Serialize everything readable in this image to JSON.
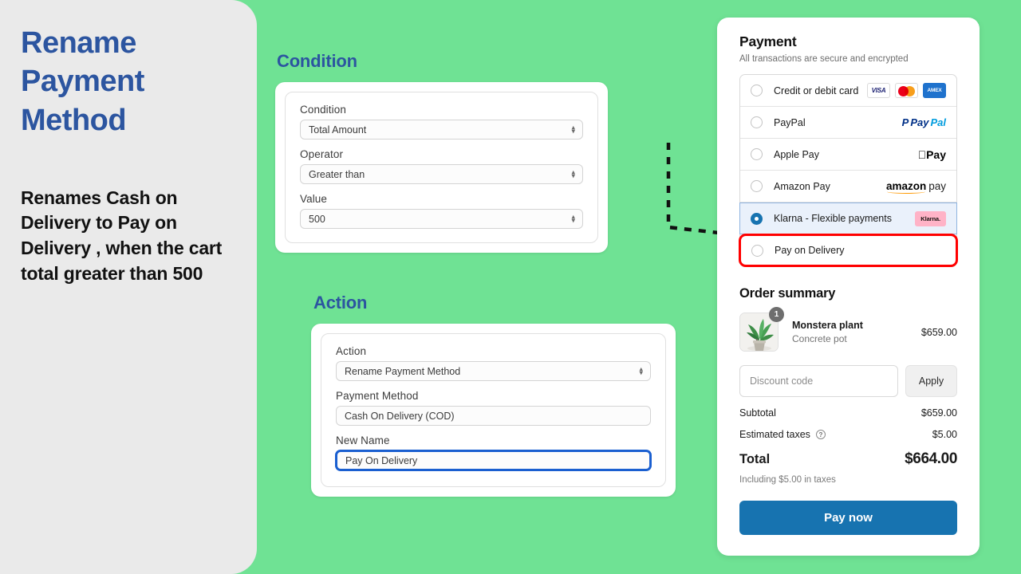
{
  "left_panel": {
    "title": "Rename Payment Method",
    "description": "Renames Cash on Delivery to Pay on Delivery , when the cart total greater than 500"
  },
  "condition_section": {
    "heading": "Condition",
    "fields": [
      {
        "label": "Condition",
        "value": "Total Amount",
        "has_stepper": true
      },
      {
        "label": "Operator",
        "value": "Greater than",
        "has_stepper": true
      },
      {
        "label": "Value",
        "value": "500",
        "has_stepper": true
      }
    ]
  },
  "action_section": {
    "heading": "Action",
    "fields": [
      {
        "label": "Action",
        "value": "Rename Payment Method",
        "has_stepper": true
      },
      {
        "label": "Payment Method",
        "value": "Cash On Delivery (COD)",
        "has_stepper": false
      },
      {
        "label": "New Name",
        "value": "Pay On Delivery",
        "has_stepper": false,
        "focused": true
      }
    ]
  },
  "checkout": {
    "payment": {
      "title": "Payment",
      "subtitle": "All transactions are secure and encrypted",
      "methods": [
        {
          "label": "Credit or debit card",
          "selected": false,
          "logos": [
            "visa",
            "mastercard",
            "amex"
          ]
        },
        {
          "label": "PayPal",
          "selected": false,
          "logos": [
            "paypal"
          ]
        },
        {
          "label": "Apple Pay",
          "selected": false,
          "logos": [
            "applepay"
          ]
        },
        {
          "label": "Amazon Pay",
          "selected": false,
          "logos": [
            "amazonpay"
          ]
        },
        {
          "label": "Klarna - Flexible payments",
          "selected": true,
          "logos": [
            "klarna"
          ]
        },
        {
          "label": "Pay on Delivery",
          "selected": false,
          "logos": [],
          "highlighted": true
        }
      ],
      "logo_text": {
        "visa": "VISA",
        "amex": "AMEX",
        "paypal_1": "P",
        "paypal_2": "Pay",
        "paypal_3": "Pal",
        "applepay": "Pay",
        "amazon": "amazon",
        "amazon_pay": "pay",
        "klarna": "Klarna."
      }
    },
    "order_summary": {
      "title": "Order summary",
      "item": {
        "name": "Monstera plant",
        "variant": "Concrete pot",
        "quantity": "1",
        "price": "$659.00"
      },
      "discount_placeholder": "Discount code",
      "apply_label": "Apply",
      "totals": [
        {
          "label": "Subtotal",
          "value": "$659.00",
          "info": false
        },
        {
          "label": "Estimated taxes",
          "value": "$5.00",
          "info": true
        }
      ],
      "grand_total": {
        "label": "Total",
        "value": "$664.00"
      },
      "tax_note": "Including $5.00 in taxes",
      "pay_button": "Pay now"
    }
  },
  "colors": {
    "background_green": "#6FE294",
    "sidebar_gray": "#EAEAEA",
    "heading_blue": "#2C55A0",
    "accent_blue": "#1773B0",
    "highlight_red": "#FF0000",
    "klarna_pink": "#FFB3C7"
  }
}
